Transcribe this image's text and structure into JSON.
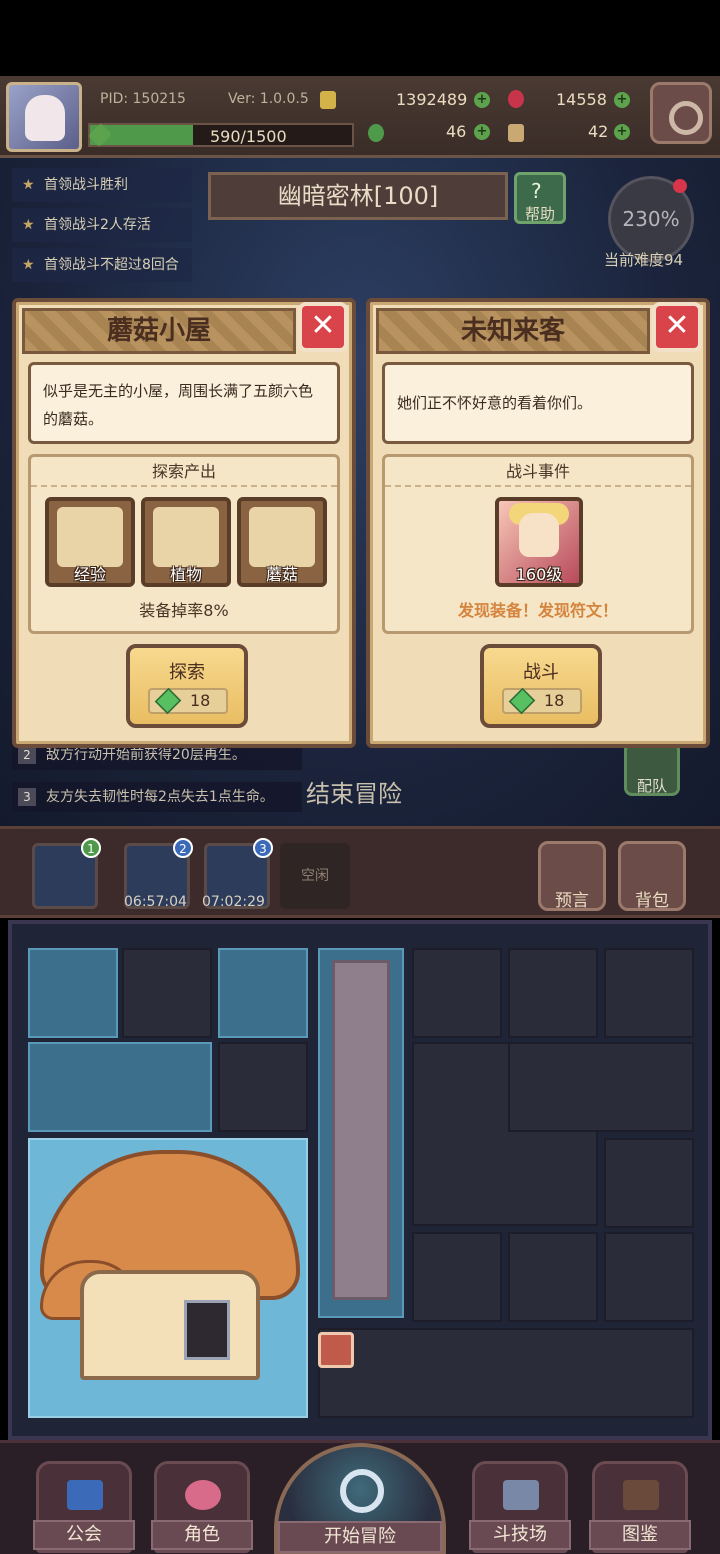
{
  "header": {
    "pid": "PID: 150215",
    "version": "Ver: 1.0.0.5",
    "gold": "1392489",
    "gems": "14558",
    "xp_text": "590/1500",
    "xp_progress": 0.393,
    "clover": "46",
    "keys": "42"
  },
  "quests": [
    "首领战斗胜利",
    "首领战斗2人存活",
    "首领战斗不超过8回合"
  ],
  "stage": {
    "name": "幽暗密林[100]",
    "help_label": "帮助",
    "help_glyph": "?"
  },
  "difficulty": {
    "percent": "230%",
    "label": "当前难度94"
  },
  "rules": [
    {
      "num": "2",
      "text": "敌方行动开始前获得20层再生。"
    },
    {
      "num": "3",
      "text": "友方失去韧性时每2点失去1点生命。"
    }
  ],
  "end_adventure": "结束冒险",
  "team_label": "配队",
  "cards": {
    "left": {
      "title": "蘑菇小屋",
      "close": "✕",
      "description": "似乎是无主的小屋，周围长满了五颜六色的蘑菇。",
      "section_title": "探索产出",
      "outputs": [
        "经验",
        "植物",
        "蘑菇"
      ],
      "drop_rate": "装备掉率8%",
      "action": "探索",
      "cost": "18"
    },
    "right": {
      "title": "未知来客",
      "close": "✕",
      "description": "她们正不怀好意的看着你们。",
      "section_title": "战斗事件",
      "enemy_level": "160级",
      "find_text": "发现装备！发现符文！",
      "action": "战斗",
      "cost": "18"
    }
  },
  "party": {
    "slots": [
      "1",
      "2",
      "3"
    ],
    "times": [
      "06:57:04",
      "07:02:29"
    ],
    "idle": "空闲",
    "prophecy": "预言",
    "backpack": "背包"
  },
  "nav": {
    "guild": "公会",
    "character": "角色",
    "start": "开始冒险",
    "arena": "斗技场",
    "codex": "图鉴"
  },
  "colors": {
    "accent_green": "#59c061",
    "close_red": "#d8444a",
    "find_orange": "#d4843c",
    "card_bg": "#f0dcb6"
  }
}
